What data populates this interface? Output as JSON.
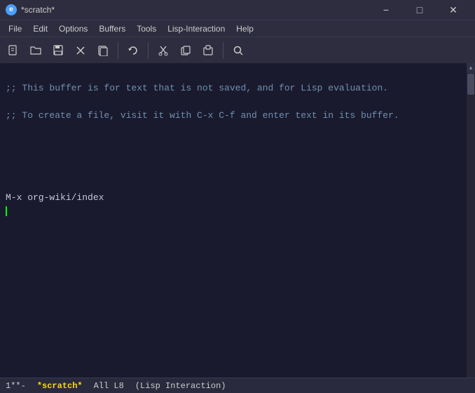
{
  "titlebar": {
    "icon_label": "e",
    "title": "*scratch*",
    "minimize_label": "−",
    "maximize_label": "□",
    "close_label": "✕"
  },
  "menubar": {
    "items": [
      "File",
      "Edit",
      "Options",
      "Buffers",
      "Tools",
      "Lisp-Interaction",
      "Help"
    ]
  },
  "toolbar": {
    "buttons": [
      {
        "name": "new-file",
        "symbol": "📄"
      },
      {
        "name": "open-file",
        "symbol": "📂"
      },
      {
        "name": "save-file",
        "symbol": "💾"
      },
      {
        "name": "close-buffer",
        "symbol": "✕"
      },
      {
        "name": "save-copy",
        "symbol": "📄"
      },
      {
        "name": "undo",
        "symbol": "↩"
      },
      {
        "name": "cut",
        "symbol": "✂"
      },
      {
        "name": "copy",
        "symbol": "⎘"
      },
      {
        "name": "paste",
        "symbol": "📋"
      },
      {
        "name": "search",
        "symbol": "🔍"
      }
    ]
  },
  "editor": {
    "line1": ";; This buffer is for text that is not saved, and for Lisp evaluation.",
    "line2": ";; To create a file, visit it with C-x C-f and enter text in its buffer.",
    "line3": "",
    "line4": "",
    "line5": "M-x org-wiki/index"
  },
  "statusbar": {
    "position": "1",
    "mode_indicator": "**-",
    "buffer_name": "*scratch*",
    "position_label": "All L8",
    "major_mode": "(Lisp Interaction)"
  }
}
